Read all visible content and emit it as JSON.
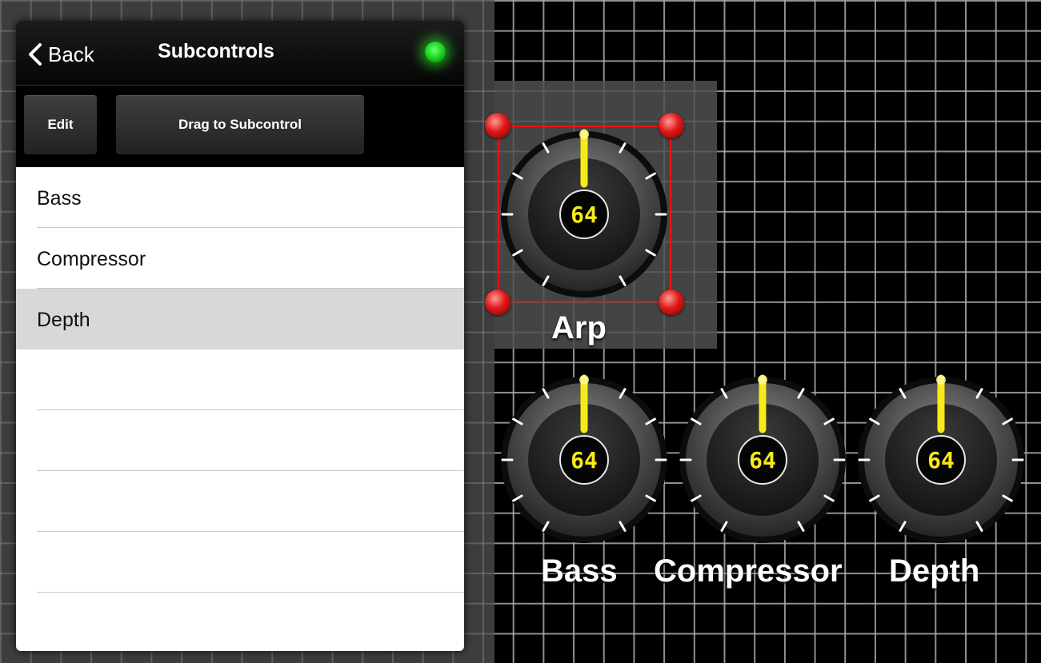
{
  "nav": {
    "back_label": "Back",
    "title": "Subcontrols"
  },
  "toolbar": {
    "edit_label": "Edit",
    "drag_label": "Drag to Subcontrol"
  },
  "list": {
    "items": [
      "Bass",
      "Compressor",
      "Depth",
      "",
      "",
      "",
      ""
    ],
    "selected": "Depth"
  },
  "knobs": {
    "arp": {
      "label": "Arp",
      "value": "64"
    },
    "bass": {
      "label": "Bass",
      "value": "64"
    },
    "compressor": {
      "label": "Compressor",
      "value": "64"
    },
    "depth": {
      "label": "Depth",
      "value": "64"
    }
  },
  "colors": {
    "indicator": "#f7ea18",
    "status_led": "#19d41e",
    "selection": "#e11111"
  }
}
